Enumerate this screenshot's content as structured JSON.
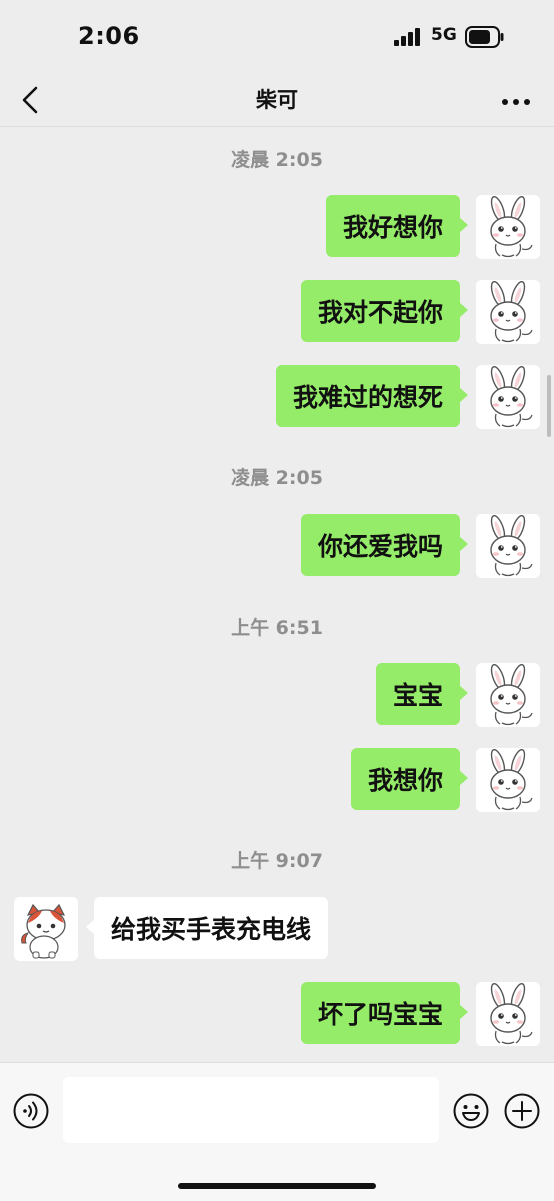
{
  "status_bar": {
    "time": "2:06",
    "network": "5G"
  },
  "nav": {
    "title": "柴可"
  },
  "chat": {
    "ts1": "凌晨 2:05",
    "msg1": "我好想你",
    "msg2": "我对不起你",
    "msg3": "我难过的想死",
    "ts2": "凌晨 2:05",
    "msg4": "你还爱我吗",
    "ts3": "上午 6:51",
    "msg5": "宝宝",
    "msg6": "我想你",
    "ts4": "上午 9:07",
    "msg7": "给我买手表充电线",
    "msg8": "坏了吗宝宝"
  },
  "input": {
    "value": ""
  },
  "icons": {
    "back": "chevron-left-icon",
    "more": "more-dots-icon",
    "voice": "voice-icon",
    "emoji": "emoji-icon",
    "plus": "plus-icon"
  },
  "colors": {
    "outgoing_bubble": "#95ec69",
    "incoming_bubble": "#ffffff",
    "background": "#ededed"
  }
}
